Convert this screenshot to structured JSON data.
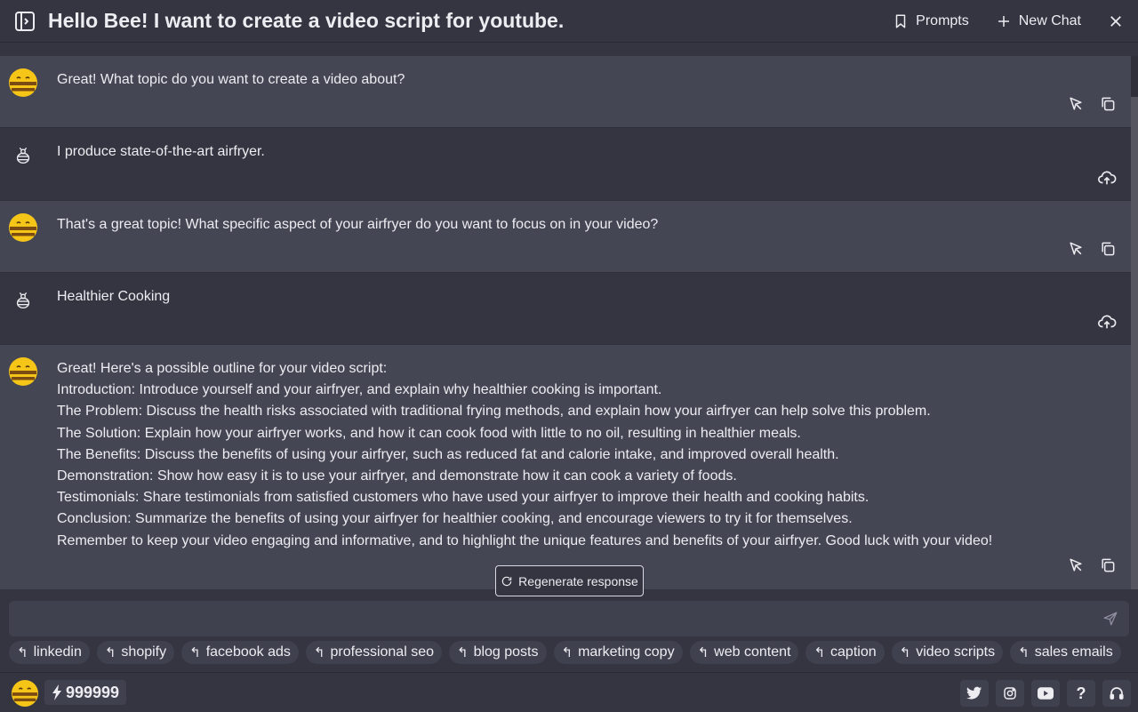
{
  "header": {
    "title": "Hello Bee! I want to create a video script for youtube.",
    "prompts_label": "Prompts",
    "new_chat_label": "New Chat"
  },
  "messages": [
    {
      "role": "bot",
      "lines": [
        "Great! What topic do you want to create a video about?"
      ]
    },
    {
      "role": "user",
      "lines": [
        "I produce state-of-the-art airfryer."
      ]
    },
    {
      "role": "bot",
      "lines": [
        "That's a great topic! What specific aspect of your airfryer do you want to focus on in your video?"
      ]
    },
    {
      "role": "user",
      "lines": [
        "Healthier Cooking"
      ]
    },
    {
      "role": "bot",
      "lines": [
        "Great! Here's a possible outline for your video script:",
        "Introduction: Introduce yourself and your airfryer, and explain why healthier cooking is important.",
        "The Problem: Discuss the health risks associated with traditional frying methods, and explain how your airfryer can help solve this problem.",
        "The Solution: Explain how your airfryer works, and how it can cook food with little to no oil, resulting in healthier meals.",
        "The Benefits: Discuss the benefits of using your airfryer, such as reduced fat and calorie intake, and improved overall health.",
        "Demonstration: Show how easy it is to use your airfryer, and demonstrate how it can cook a variety of foods.",
        "Testimonials: Share testimonials from satisfied customers who have used your airfryer to improve their health and cooking habits.",
        "Conclusion: Summarize the benefits of using your airfryer for healthier cooking, and encourage viewers to try it for themselves.",
        "Remember to keep your video engaging and informative, and to highlight the unique features and benefits of your airfryer. Good luck with your video!"
      ]
    }
  ],
  "regenerate_label": "Regenerate response",
  "input": {
    "value": "",
    "placeholder": ""
  },
  "chips": [
    "linkedin",
    "shopify",
    "facebook ads",
    "professional seo",
    "blog posts",
    "marketing copy",
    "web content",
    "caption",
    "video scripts",
    "sales emails"
  ],
  "footer": {
    "credits": "999999"
  },
  "colors": {
    "bg": "#343541",
    "bot_bg": "#444654",
    "input_bg": "#40414f",
    "text": "#ececf1",
    "bee_yellow": "#f5c518"
  },
  "icons": [
    "sidebar-toggle-icon",
    "bookmark-icon",
    "plus-icon",
    "close-icon",
    "bee-avatar-icon",
    "user-bee-icon",
    "select-pointer-icon",
    "copy-icon",
    "upload-cloud-icon",
    "refresh-icon",
    "send-icon",
    "return-arrow-icon",
    "bolt-icon",
    "twitter-icon",
    "instagram-icon",
    "youtube-icon",
    "help-icon",
    "headset-icon"
  ]
}
